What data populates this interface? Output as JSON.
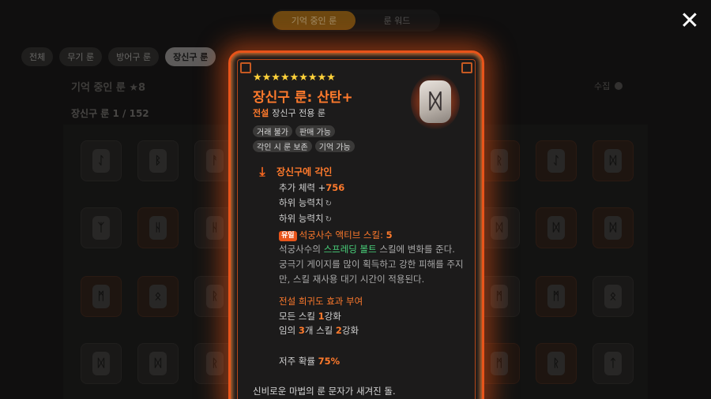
{
  "top_tabs": [
    {
      "label": "기억 중인 룬",
      "active": true
    },
    {
      "label": "룬 워드",
      "active": false
    }
  ],
  "close_icon": "close-icon",
  "filters": [
    {
      "label": "전체",
      "active": false
    },
    {
      "label": "무기 룬",
      "active": false
    },
    {
      "label": "방어구 룬",
      "active": false
    },
    {
      "label": "장신구 룬",
      "active": true
    }
  ],
  "background": {
    "section_title": "기억 중인 룬 ★8",
    "count_label": "장신구 룬  1 / 152",
    "receive_label": "수집"
  },
  "popup": {
    "stars": "★★★★★★★★★",
    "star_count": 9,
    "title": "장신구 룬: 산탄+",
    "grade": "전설",
    "type": "장신구 전용 룬",
    "icon": "rune-stone-icon",
    "icon_glyph": "ᛞ",
    "tags": [
      "거래 불가",
      "판매 가능",
      "각인 시 룬 보존",
      "기억 가능"
    ],
    "engrave_title": "장신구에 각인",
    "stat1_label": "추가 체력 +",
    "stat1_value": "756",
    "sub_stat_1": "하위 능력치",
    "sub_stat_2": "하위 능력치",
    "unique_badge": "유일",
    "unique_text": "석궁사수 액티브 스킬: ",
    "unique_value": "5",
    "effect_line_1_pre": "석궁사수의 ",
    "effect_skill": "스프레딩 볼트",
    "effect_line_1_post": " 스킬에 변화를 준다.",
    "effect_line_2": "궁극기 게이지를 많이 획득하고 강한 피해를 주지만, 스킬 재사용 대기 시간이 적용된다.",
    "legend_title": "전설 희귀도 효과 부여",
    "legend_1_pre": "모든 스킬 ",
    "legend_1_val": "1",
    "legend_1_post": "강화",
    "legend_2_pre": "임의 ",
    "legend_2_val1": "3",
    "legend_2_mid": "개 스킬 ",
    "legend_2_val2": "2",
    "legend_2_post": "강화",
    "curse_label": "저주 확률 ",
    "curse_value": "75%",
    "description": "신비로운 마법의 룬 문자가 새겨진 돌."
  },
  "colors": {
    "accent": "#ff7a2c",
    "border_glow": "#e8541a",
    "star": "#ffd23a",
    "skill_green": "#49d07a",
    "tab_active": "#a56a14"
  }
}
